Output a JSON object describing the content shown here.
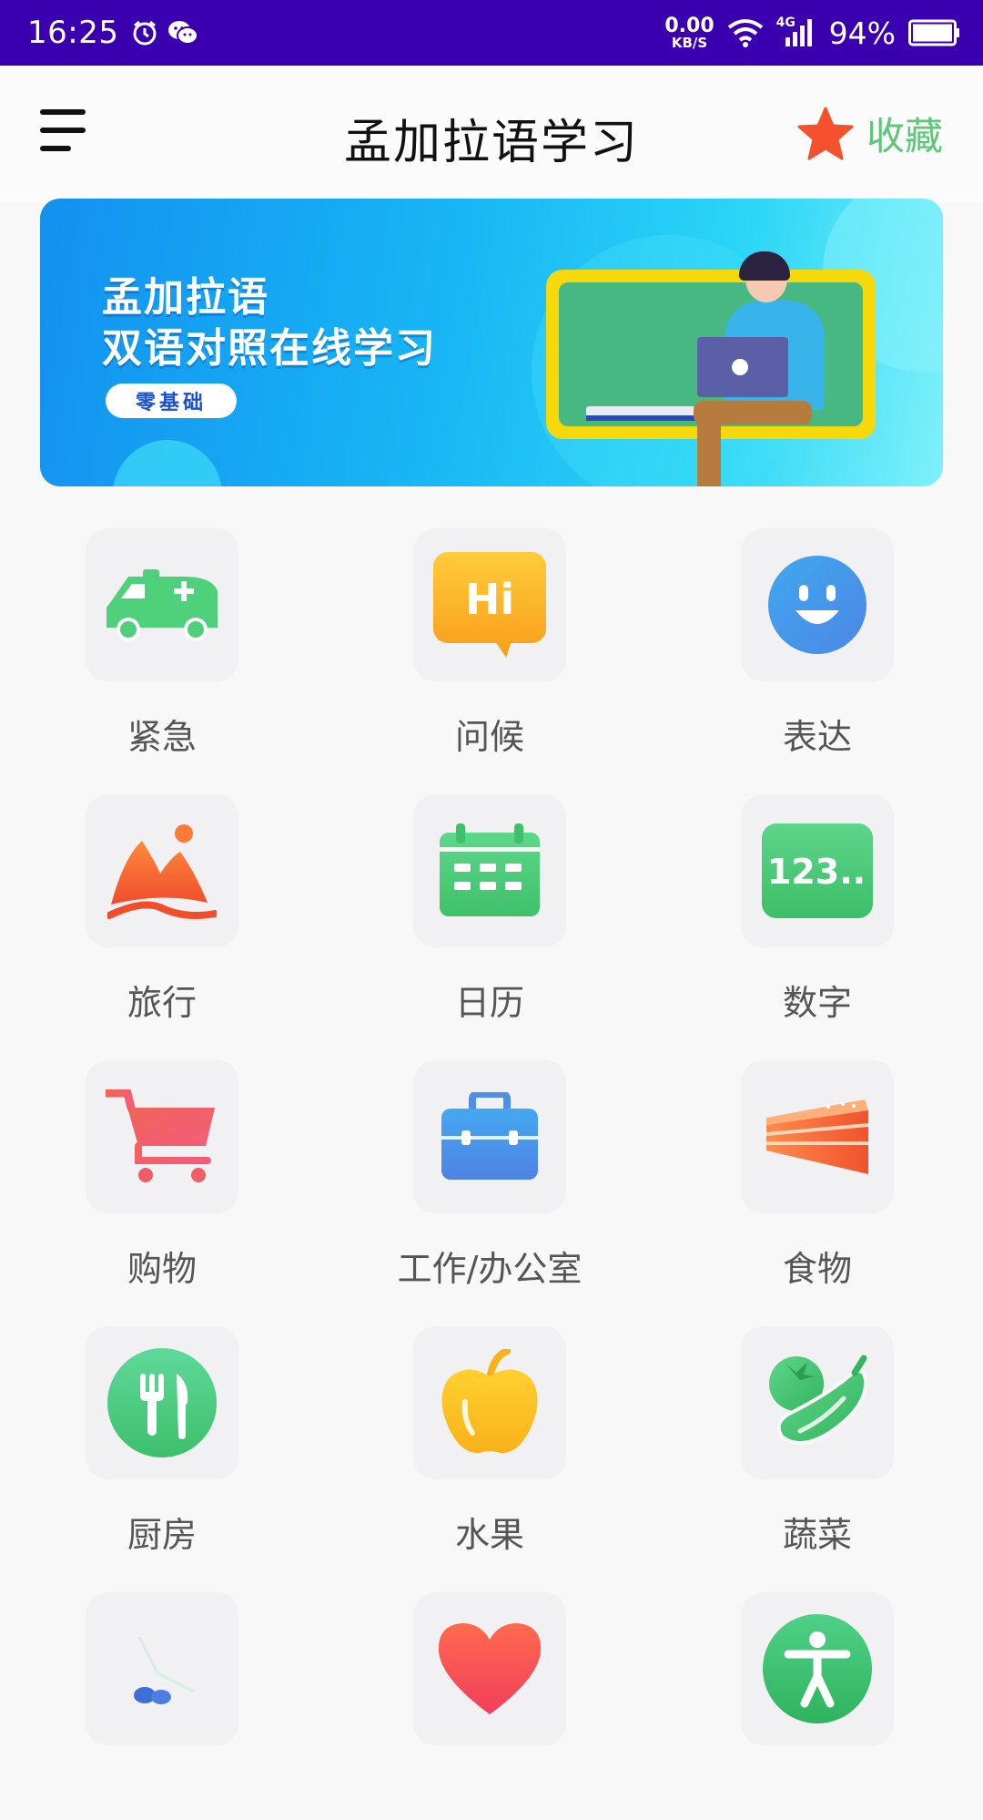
{
  "status_bar": {
    "time": "16:25",
    "net_speed_value": "0.00",
    "net_speed_unit": "KB/S",
    "signal_label": "4G",
    "battery": "94%",
    "icons": [
      "alarm-icon",
      "wechat-icon",
      "wifi-icon",
      "signal-icon",
      "battery-icon"
    ]
  },
  "header": {
    "title": "孟加拉语学习",
    "favorite_label": "收藏",
    "favorite_icon": "star-icon",
    "favorite_color": "#5ec777",
    "star_color": "#f4512c"
  },
  "banner": {
    "line1": "孟加拉语",
    "line2": "双语对照在线学习",
    "pill": "零基础"
  },
  "categories": [
    {
      "label": "紧急",
      "icon": "ambulance-icon"
    },
    {
      "label": "问候",
      "icon": "hi-bubble-icon"
    },
    {
      "label": "表达",
      "icon": "smiley-icon"
    },
    {
      "label": "旅行",
      "icon": "mountain-icon"
    },
    {
      "label": "日历",
      "icon": "calendar-icon"
    },
    {
      "label": "数字",
      "icon": "numbers-icon",
      "icon_text": "123.."
    },
    {
      "label": "购物",
      "icon": "shopping-cart-icon"
    },
    {
      "label": "工作/办公室",
      "icon": "briefcase-icon"
    },
    {
      "label": "食物",
      "icon": "cake-icon"
    },
    {
      "label": "厨房",
      "icon": "fork-knife-icon"
    },
    {
      "label": "水果",
      "icon": "apple-icon"
    },
    {
      "label": "蔬菜",
      "icon": "vegetables-icon"
    },
    {
      "label": "",
      "icon": "shoes-icon"
    },
    {
      "label": "",
      "icon": "heart-icon"
    },
    {
      "label": "",
      "icon": "person-icon"
    }
  ]
}
